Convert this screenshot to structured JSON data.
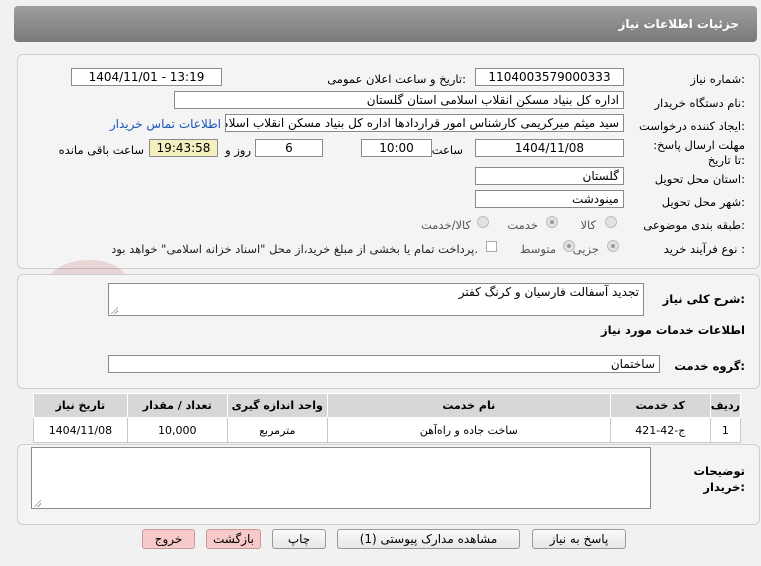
{
  "header": {
    "title": "جزئیات اطلاعات نیاز"
  },
  "form": {
    "need_number_label": "شماره نیاز:",
    "need_number": "1104003579000333",
    "announce_label": "تاریخ و ساعت اعلان عمومی:",
    "announce_value": "1404/11/01 - 13:19",
    "buyer_org_label": "نام دستگاه خریدار:",
    "buyer_org": "اداره کل بنیاد مسکن انقلاب اسلامی استان گلستان",
    "creator_label": "ایجاد کننده درخواست:",
    "creator": "سید میثم میرکریمی کارشناس امور قراردادها اداره کل بنیاد مسکن انقلاب اسلامی استان گلستان",
    "contact_link": "اطلاعات تماس خریدار",
    "deadline_label": "مهلت ارسال پاسخ: تا تاریخ:",
    "deadline_date": "1404/11/08",
    "time_label": "ساعت",
    "deadline_time": "10:00",
    "days": "6",
    "days_label": "روز و",
    "remaining_time": "19:43:58",
    "remaining_label": "ساعت باقی مانده",
    "province_label": "استان محل تحویل:",
    "province": "گلستان",
    "city_label": "شهر محل تحویل:",
    "city": "مینودشت",
    "category_label": "طبقه بندی موضوعی:",
    "category_options": [
      "کالا",
      "خدمت",
      "کالا/خدمت"
    ],
    "category_selected": "خدمت",
    "process_label": "نوع فرآیند خرید :",
    "process_options": [
      "جزیی",
      "متوسط"
    ],
    "process_selected": "جزیی",
    "payment_note": "پرداخت تمام یا بخشی از مبلغ خرید،از محل \"اسناد خزانه اسلامی\" خواهد بود."
  },
  "description": {
    "label": "شرح کلی نیاز:",
    "value": "تجدید آسفالت فارسیان و کرنگ کفتر"
  },
  "services": {
    "section_title": "اطلاعات خدمات مورد نیاز",
    "group_label": "گروه خدمت:",
    "group_value": "ساختمان",
    "columns": [
      "ردیف",
      "کد خدمت",
      "نام خدمت",
      "واحد اندازه گیری",
      "تعداد / مقدار",
      "تاریخ نیاز"
    ],
    "rows": [
      [
        "1",
        "ج-42-421",
        "ساخت جاده و راه‌آهن",
        "مترمربع",
        "10,000",
        "1404/11/08"
      ]
    ]
  },
  "notes": {
    "label": "توضیحات خریدار:",
    "value": ""
  },
  "buttons": {
    "reply": "پاسخ به نیاز",
    "attachments": "مشاهده مدارک پیوستی (1)",
    "print": "چاپ",
    "back": "بازگشت",
    "exit": "خروج"
  },
  "watermark": {
    "text": "AriaTender.net",
    "color": "#b04040"
  },
  "colors": {
    "header": "#8a8a8a",
    "remaining_bg": "#f3efbe",
    "link": "#1a55b8",
    "back_btn": "#f7c9c9"
  }
}
